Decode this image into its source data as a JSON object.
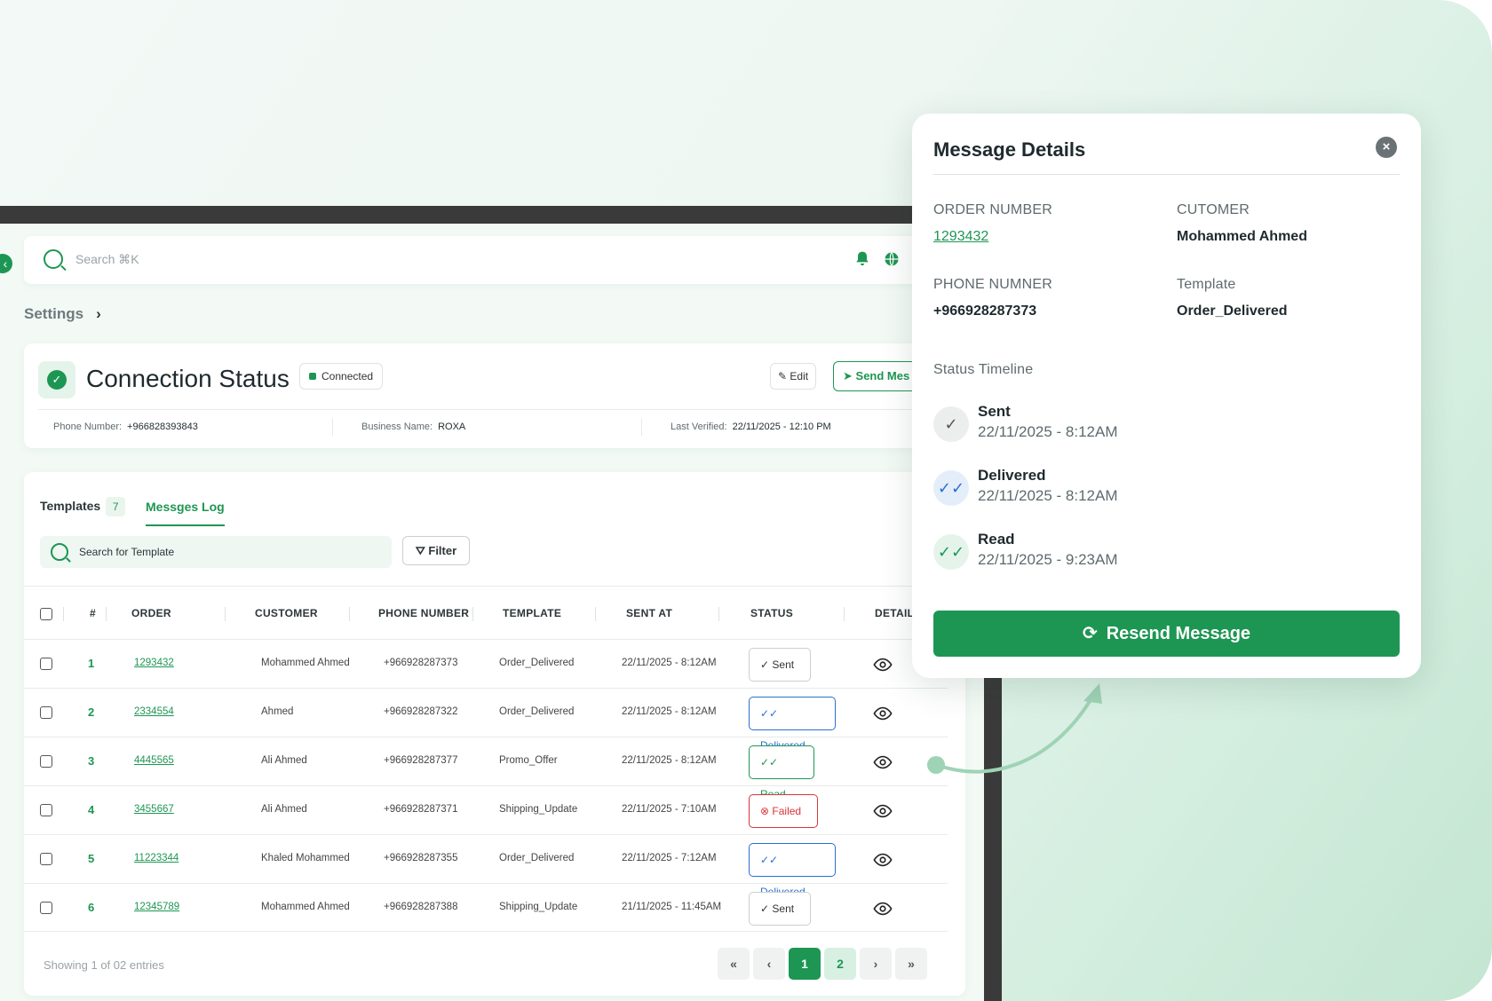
{
  "topbar": {
    "search_placeholder": "Search ⌘K"
  },
  "breadcrumb": {
    "label": "Settings"
  },
  "connection": {
    "title": "Connection Status",
    "badge": "Connected",
    "edit_label": "Edit",
    "send_label": "Send Mes",
    "phone_label": "Phone Number:",
    "phone_value": "+966828393843",
    "business_label": "Business Name:",
    "business_value": "ROXA",
    "verified_label": "Last Verified:",
    "verified_value": "22/11/2025 - 12:10 PM"
  },
  "tabs": {
    "templates_label": "Templates",
    "templates_count": "7",
    "log_label": "Messges Log"
  },
  "table_tools": {
    "search_placeholder": "Search for Template",
    "filter_label": "Filter"
  },
  "table": {
    "headers": [
      "#",
      "ORDER",
      "CUSTOMER",
      "PHONE NUMBER",
      "TEMPLATE",
      "SENT AT",
      "STATUS",
      "DETAIL"
    ],
    "rows": [
      {
        "num": "1",
        "order": "1293432",
        "customer": "Mohammed Ahmed",
        "phone": "+966928287373",
        "template": "Order_Delivered",
        "sent_at": "22/11/2025 - 8:12AM",
        "status": "Sent"
      },
      {
        "num": "2",
        "order": "2334554",
        "customer": "Ahmed",
        "phone": "+966928287322",
        "template": "Order_Delivered",
        "sent_at": "22/11/2025 - 8:12AM",
        "status": "Delivered"
      },
      {
        "num": "3",
        "order": "4445565",
        "customer": "Ali Ahmed",
        "phone": "+966928287377",
        "template": "Promo_Offer",
        "sent_at": "22/11/2025 - 8:12AM",
        "status": "Read"
      },
      {
        "num": "4",
        "order": "3455667",
        "customer": "Ali Ahmed",
        "phone": "+966928287371",
        "template": "Shipping_Update",
        "sent_at": "22/11/2025 - 7:10AM",
        "status": "Failed"
      },
      {
        "num": "5",
        "order": "11223344",
        "customer": "Khaled Mohammed",
        "phone": "+966928287355",
        "template": "Order_Delivered",
        "sent_at": "22/11/2025 - 7:12AM",
        "status": "Delivered"
      },
      {
        "num": "6",
        "order": "12345789",
        "customer": "Mohammed Ahmed",
        "phone": "+966928287388",
        "template": "Shipping_Update",
        "sent_at": "21/11/2025 - 11:45AM",
        "status": "Sent"
      }
    ]
  },
  "pagination": {
    "showing": "Showing 1 of 02 entries",
    "first": "«",
    "prev": "‹",
    "page1": "1",
    "page2": "2",
    "next": "›",
    "last": "»"
  },
  "modal": {
    "title": "Message Details",
    "close": "×",
    "order_label": "ORDER NUMBER",
    "order_value": "1293432",
    "customer_label": "CUTOMER",
    "customer_value": "Mohammed Ahmed",
    "phone_label": "PHONE NUMNER",
    "phone_value": "+966928287373",
    "template_label": "Template",
    "template_value": "Order_Delivered",
    "timeline_title": "Status Timeline",
    "timeline": [
      {
        "name": "Sent",
        "time": "22/11/2025  -  8:12AM"
      },
      {
        "name": "Delivered",
        "time": "22/11/2025  -  8:12AM"
      },
      {
        "name": "Read",
        "time": "22/11/2025  -  9:23AM"
      }
    ],
    "resend_label": "Resend Message"
  },
  "colors": {
    "brand": "#1e9653",
    "delivered": "#2b6fd0",
    "failed": "#d9343a"
  }
}
